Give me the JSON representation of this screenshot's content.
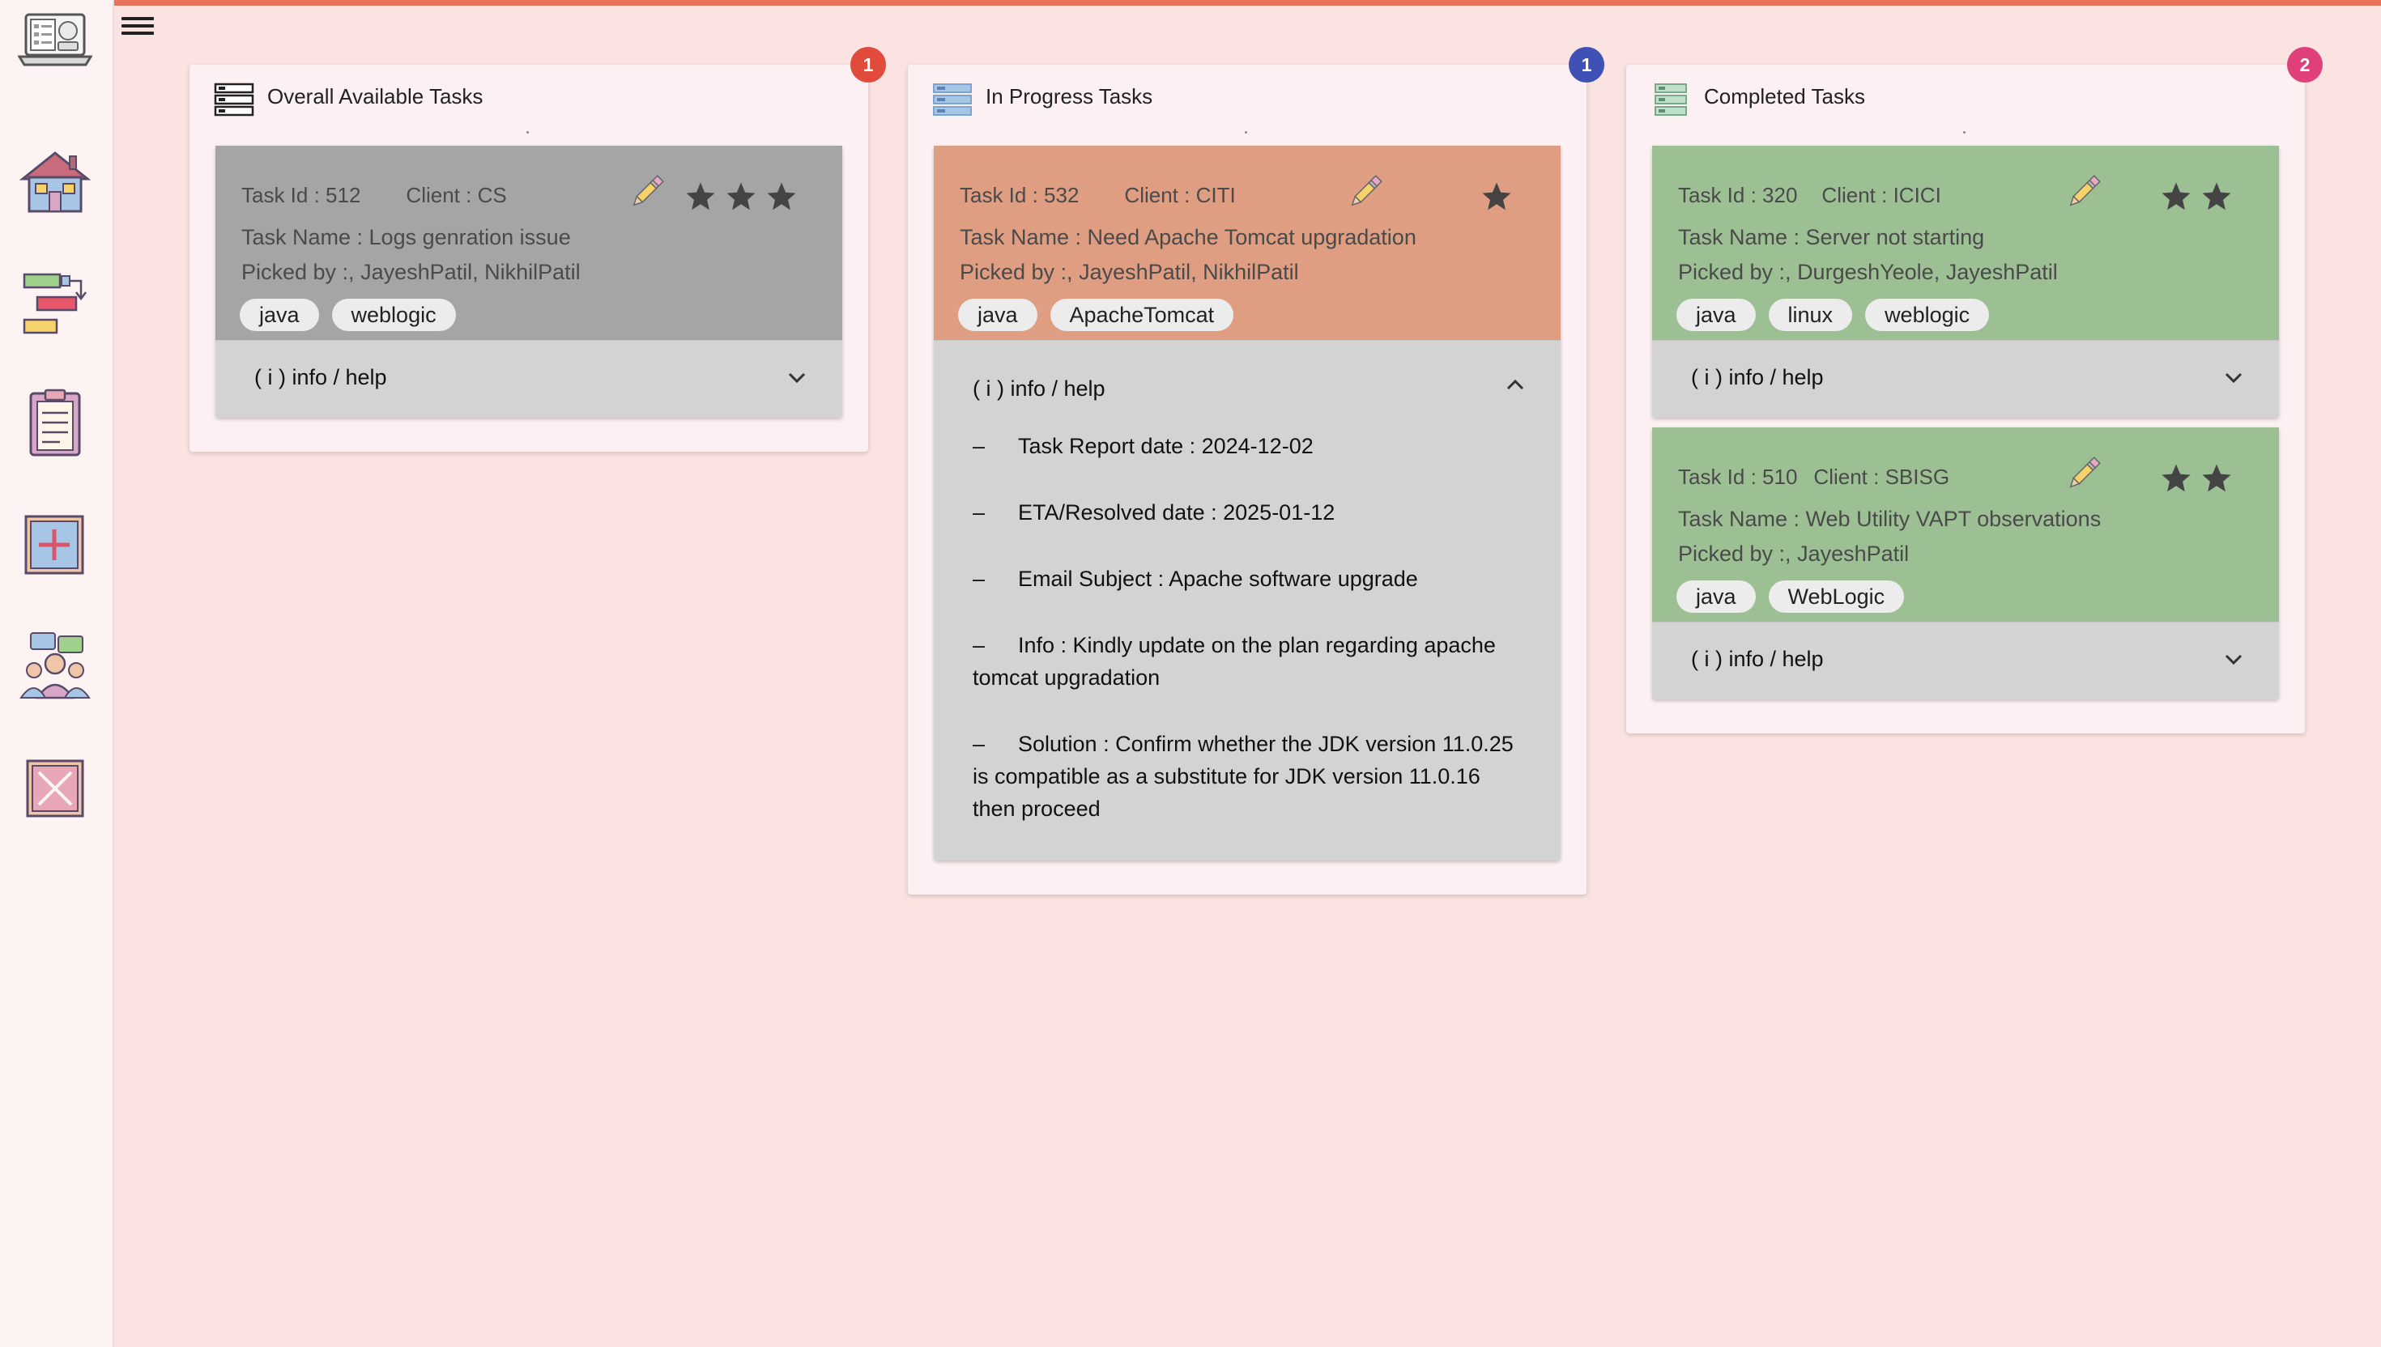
{
  "app": {
    "logo_icon": "laptop-tasks-logo-icon",
    "menu_icon": "hamburger-menu-icon"
  },
  "sidebar": {
    "items": [
      {
        "icon": "home-icon"
      },
      {
        "icon": "task-flow-icon"
      },
      {
        "icon": "clipboard-icon"
      },
      {
        "icon": "add-task-icon"
      },
      {
        "icon": "team-chat-icon"
      },
      {
        "icon": "close-box-icon"
      }
    ]
  },
  "colors": {
    "accent_line": "#e9735a",
    "badge_available": "#e04b3c",
    "badge_progress": "#3f51b5",
    "badge_completed": "#e0407a",
    "card_available": "#a5a5a5",
    "card_progress": "#df9d81",
    "card_completed": "#9cc093"
  },
  "columns": [
    {
      "title": "Overall Available Tasks",
      "count": "1",
      "tasks": [
        {
          "task_id": "Task Id : 512",
          "client": "Client : CS",
          "name": "Task Name : Logs genration issue",
          "picked_by": "Picked by :, JayeshPatil, NikhilPatil",
          "tags": [
            "java",
            "weblogic"
          ],
          "stars": 3,
          "info_label": "( i ) info / help"
        }
      ]
    },
    {
      "title": "In Progress Tasks",
      "count": "1",
      "tasks": [
        {
          "task_id": "Task Id : 532",
          "client": "Client : CITI",
          "name": "Task Name : Need Apache Tomcat upgradation",
          "picked_by": "Picked by :, JayeshPatil, NikhilPatil",
          "tags": [
            "java",
            "ApacheTomcat"
          ],
          "stars": 1,
          "info_label": "( i ) info / help",
          "info_expanded": true,
          "info_lines": [
            "Task Report date : 2024-12-02",
            "ETA/Resolved date : 2025-01-12",
            "Email Subject : Apache software upgrade",
            "Info : Kindly update on the plan regarding apache tomcat upgradation",
            "Solution : Confirm whether the JDK version 11.0.25 is compatible as a substitute for JDK version 11.0.16 then proceed"
          ]
        }
      ]
    },
    {
      "title": "Completed Tasks",
      "count": "2",
      "tasks": [
        {
          "task_id": "Task Id : 320",
          "client": "Client : ICICI",
          "name": "Task Name : Server not starting",
          "picked_by": "Picked by :, DurgeshYeole, JayeshPatil",
          "tags": [
            "java",
            "linux",
            "weblogic"
          ],
          "stars": 2,
          "info_label": "( i ) info / help"
        },
        {
          "task_id": "Task Id : 510",
          "client": "Client : SBISG",
          "name": "Task Name : Web Utility VAPT observations",
          "picked_by": "Picked by :, JayeshPatil",
          "tags": [
            "java",
            "WebLogic"
          ],
          "stars": 2,
          "info_label": "( i ) info / help"
        }
      ]
    }
  ]
}
